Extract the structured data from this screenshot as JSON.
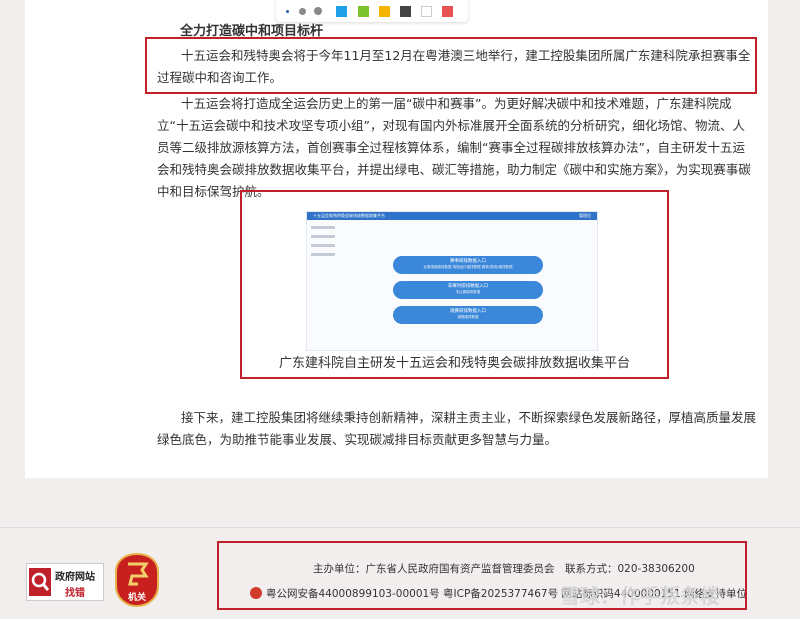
{
  "article": {
    "heading": "全力打造碳中和项目标杆",
    "p1": "十五运会和残特奥会将于今年11月至12月在粤港澳三地举行，建工控股集团所属广东建科院承担赛事全过程碳中和咨询工作。",
    "p2": "十五运会将打造成全运会历史上的第一届“碳中和赛事”。为更好解决碳中和技术难题，广东建科院成立“十五运会碳中和技术攻坚专项小组”，对现有国内外标准展开全面系统的分析研究，细化场馆、物流、人员等二级排放源核算方法，首创赛事全过程核算体系，编制“赛事全过程碳排放核算办法”，自主研发十五运会和残特奥会碳排放数据收集平台，并提出绿电、碳汇等措施，助力制定《碳中和实施方案》，为实现赛事碳中和目标保驾护航。",
    "p3": "接下来，建工控股集团将继续秉持创新精神，深耕主责主业，不断探索绿色发展新路径，厚植高质量发展绿色底色，为助推节能事业发展、实现碳减排目标贡献更多智慧与力量。",
    "caption": "广东建科院自主研发十五运会和残特奥会碳排放数据收集平台"
  },
  "toolbar": {
    "colors": [
      "#1e9fe6",
      "#7cc22a",
      "#f4b400",
      "#444444",
      "#ffffff",
      "#e85252"
    ]
  },
  "screenshot": {
    "title": "十五运会和残特奥会碳排放数据收集平台",
    "user": "管理员",
    "pills": [
      {
        "title": "赛事碳排数据入口",
        "sub": "比赛场馆碳排数据    场馆运行碳排数据    赛事(物流)碳排数据"
      },
      {
        "title": "非赛时碳排数据入口",
        "sub": "非比赛碳排数据"
      },
      {
        "title": "观赛碳排数据入口",
        "sub": "观赛碳排数据"
      }
    ]
  },
  "footer": {
    "gov_line1": "政府网站",
    "gov_line2": "找错",
    "organ_label": "机关",
    "sponsor": "主办单位：广东省人民政府国有资产监督管理委员会　联系方式：020-38306200",
    "records": "粤公网安备44000899103-00001号 粤ICP备2025377467号 网站标识码4400000151 网络支持单位",
    "watermark": "雪球：作手叛条楼"
  },
  "colors": {
    "highlight_box": "#c0202a",
    "screenshot_header": "#2f72c9",
    "pill": "#3b87d9"
  }
}
